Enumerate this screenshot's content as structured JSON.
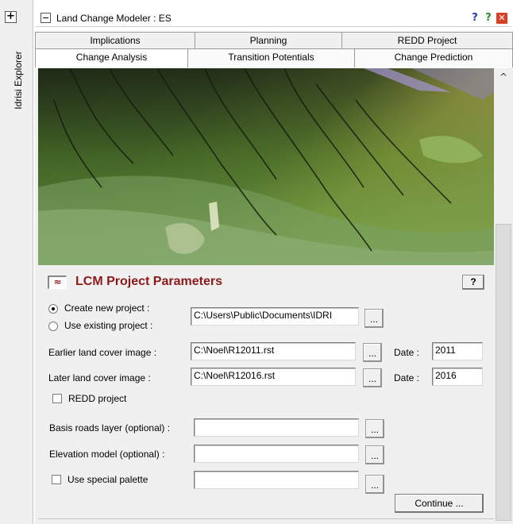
{
  "sidebar": {
    "explorer_label": "Idrisi Explorer",
    "expand_glyph": "+"
  },
  "window": {
    "title": "Land Change Modeler : ES",
    "help_icon": "?",
    "help2_icon": "?",
    "close_icon": "✕"
  },
  "tabs": {
    "row1": [
      "Implications",
      "Planning",
      "REDD Project"
    ],
    "row2": [
      "Change Analysis",
      "Transition Potentials",
      "Change Prediction"
    ],
    "active": "Change Analysis"
  },
  "scrollbar": {
    "up_icon": "^"
  },
  "params": {
    "collapse_icon": "≈",
    "title": "LCM Project Parameters",
    "help_label": "?",
    "create_new_label": "Create new project :",
    "use_existing_label": "Use existing project :",
    "project_mode": "create_new",
    "project_path": "C:\\Users\\Public\\Documents\\IDRI",
    "earlier_label": "Earlier land cover image :",
    "earlier_value": "C:\\Noel\\R12011.rst",
    "later_label": "Later land cover image :",
    "later_value": "C:\\Noel\\R12016.rst",
    "date_label": "Date :",
    "earlier_date": "2011",
    "later_date": "2016",
    "redd_label": "REDD project",
    "redd_checked": false,
    "roads_label": "Basis roads layer (optional) :",
    "roads_value": "",
    "elevation_label": "Elevation model (optional) :",
    "elevation_value": "",
    "palette_label": "Use special palette",
    "palette_checked": false,
    "palette_value": "",
    "browse_label": "...",
    "continue_label": "Continue ..."
  }
}
